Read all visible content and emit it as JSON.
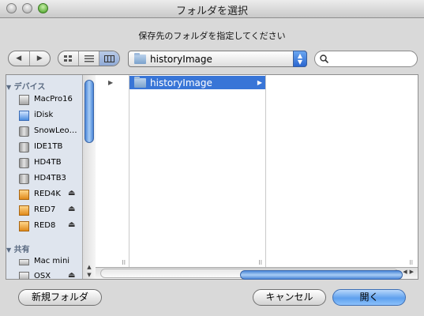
{
  "window": {
    "title": "フォルダを選択"
  },
  "prompt": "保存先のフォルダを指定してください",
  "toolbar": {
    "back_glyph": "◀",
    "forward_glyph": "▶",
    "view_modes": [
      "icon-view",
      "list-view",
      "column-view"
    ],
    "active_view": "column-view",
    "location": "historyImage",
    "search_value": ""
  },
  "sidebar": {
    "devices_header": "デバイス",
    "devices": [
      {
        "label": "MacPro16",
        "icon": "hard-disk-icon"
      },
      {
        "label": "iDisk",
        "icon": "idisk-icon"
      },
      {
        "label": "SnowLeo…",
        "icon": "hard-disk-icon"
      },
      {
        "label": "IDE1TB",
        "icon": "hard-disk-icon"
      },
      {
        "label": "HD4TB",
        "icon": "hard-disk-icon"
      },
      {
        "label": "HD4TB3",
        "icon": "hard-disk-icon"
      },
      {
        "label": "RED4K",
        "icon": "external-disk-icon",
        "eject": true
      },
      {
        "label": "RED7",
        "icon": "external-disk-icon",
        "eject": true
      },
      {
        "label": "RED8",
        "icon": "external-disk-icon",
        "eject": true
      }
    ],
    "shared_header": "共有",
    "shared": [
      {
        "label": "Mac mini",
        "icon": "mac-mini-icon"
      },
      {
        "label": "OSX",
        "icon": "network-disk-icon",
        "eject": true
      }
    ]
  },
  "columns": [
    {
      "items": []
    },
    {
      "items": [
        {
          "label": "historyImage",
          "selected": true
        }
      ]
    },
    {
      "items": []
    }
  ],
  "buttons": {
    "new_folder": "新規フォルダ",
    "cancel": "キャンセル",
    "open": "開く"
  },
  "colors": {
    "selection": "#3875d7",
    "sidebar_bg": "#dfe5ee",
    "window_bg": "#d9d9d9"
  }
}
